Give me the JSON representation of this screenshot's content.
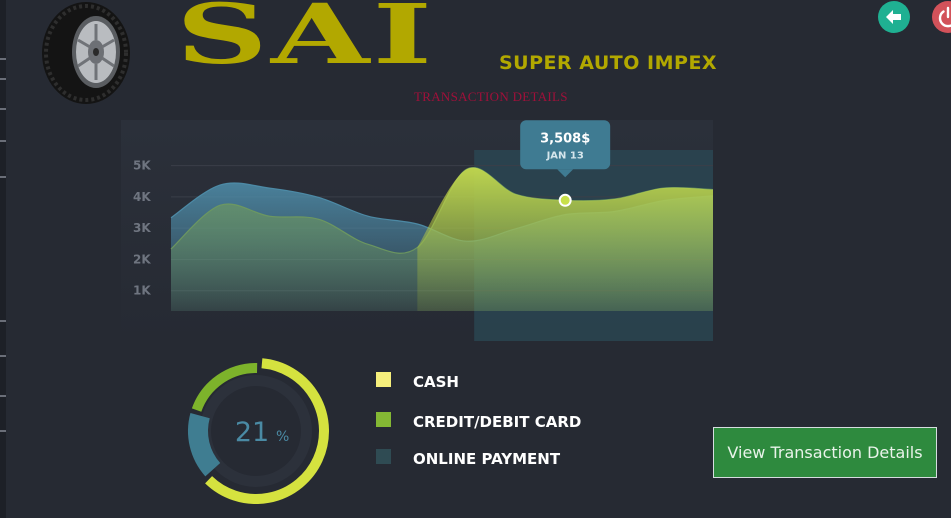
{
  "header": {
    "logo_text": "SAI",
    "company_name": "SUPER AUTO IMPEX",
    "section_title": "TRANSACTION DETAILS",
    "buttons": [
      {
        "name": "back",
        "icon": "back-arrow-icon",
        "color": "#1fb092"
      },
      {
        "name": "power",
        "icon": "power-icon",
        "color": "#d2525a"
      }
    ]
  },
  "chart_data": {
    "type": "area",
    "ylim": [
      0,
      5500
    ],
    "y_ticks": [
      "5K",
      "4K",
      "3K",
      "2K",
      "1K"
    ],
    "x": [
      0,
      1,
      2,
      3,
      4,
      5,
      6,
      7,
      8,
      9,
      10,
      11
    ],
    "series": [
      {
        "color": "#4f8fac",
        "values": [
          2950,
          4000,
          3900,
          3600,
          3000,
          2750,
          2200,
          2600,
          3050,
          3150,
          3500,
          3650
        ]
      },
      {
        "color": "#6f9a5e",
        "values": [
          1950,
          3350,
          3000,
          2900,
          2100,
          2000,
          4500,
          3700,
          3508,
          3550,
          3900,
          3850
        ]
      }
    ],
    "tooltip": {
      "value": "3,508$",
      "date": "JAN 13",
      "series_index": 1,
      "point_index": 8
    },
    "grid": true
  },
  "summary": {
    "percent_value": "21",
    "percent_unit": "%",
    "segments": [
      {
        "color": "#d5e23f",
        "fraction": 0.62
      },
      {
        "color": "#3f7d91",
        "fraction": 0.17
      },
      {
        "color": "#7db32b",
        "fraction": 0.21
      }
    ]
  },
  "legend": [
    {
      "label": "CASH",
      "color": "#f6ef7c"
    },
    {
      "label": "CREDIT/DEBIT CARD",
      "color": "#84b834"
    },
    {
      "label": "ONLINE PAYMENT",
      "color": "#2f4b53"
    }
  ],
  "actions": {
    "view_button": "View Transaction Details"
  }
}
